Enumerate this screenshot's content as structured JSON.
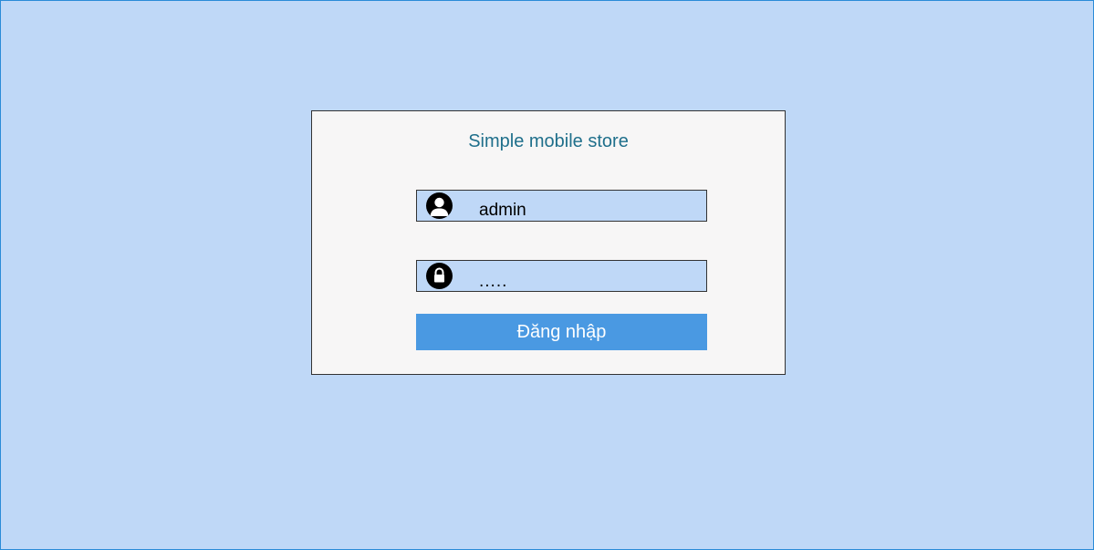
{
  "login": {
    "title": "Simple mobile store",
    "username": {
      "value": "admin",
      "icon": "user-icon"
    },
    "password": {
      "value": ".....",
      "icon": "lock-icon"
    },
    "submit_label": "Đăng nhập"
  },
  "colors": {
    "page_background": "#bfd8f7",
    "page_border": "#2a8bd8",
    "card_background": "#f7f6f6",
    "title_text": "#1f6f8b",
    "field_background": "#bfd8f7",
    "button_background": "#4a99e2",
    "button_text": "#ffffff"
  }
}
